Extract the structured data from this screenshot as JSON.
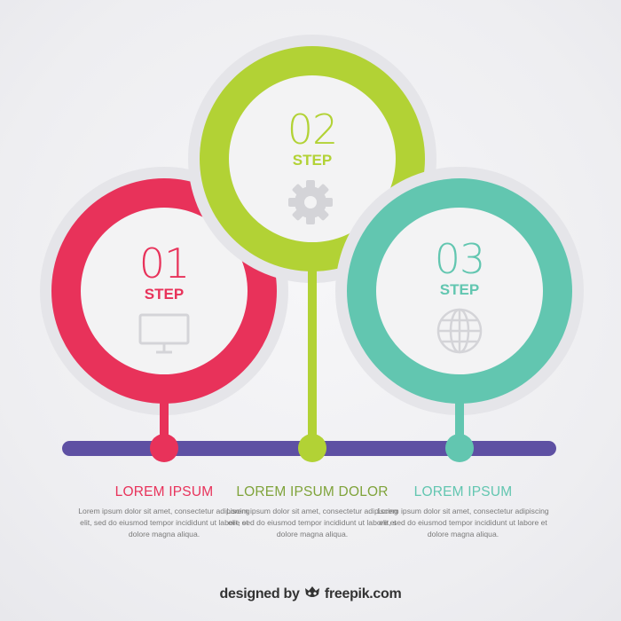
{
  "colors": {
    "step1": "#e8325a",
    "step2": "#b2d235",
    "step3": "#62c6b0",
    "timeline": "#5e50a3",
    "icon": "#d4d4d8"
  },
  "steps": [
    {
      "number": "01",
      "label": "STEP",
      "icon": "monitor-icon",
      "title": "LOREM IPSUM",
      "text": "Lorem ipsum dolor sit amet, consectetur adipiscing elit, sed do eiusmod tempor incididunt ut labore et dolore magna aliqua."
    },
    {
      "number": "02",
      "label": "STEP",
      "icon": "gear-icon",
      "title": "LOREM IPSUM DOLOR",
      "text": "Lorem ipsum dolor sit amet, consectetur adipiscing elit, sed do eiusmod tempor incididunt ut labore et dolore magna aliqua."
    },
    {
      "number": "03",
      "label": "STEP",
      "icon": "globe-icon",
      "title": "LOREM IPSUM",
      "text": "Lorem ipsum dolor sit amet, consectetur adipiscing elit, sed do eiusmod tempor incididunt ut labore et dolore magna aliqua."
    }
  ],
  "footer": {
    "prefix": "designed by",
    "brand": "freepik.com",
    "logo": "freepik-logo"
  }
}
